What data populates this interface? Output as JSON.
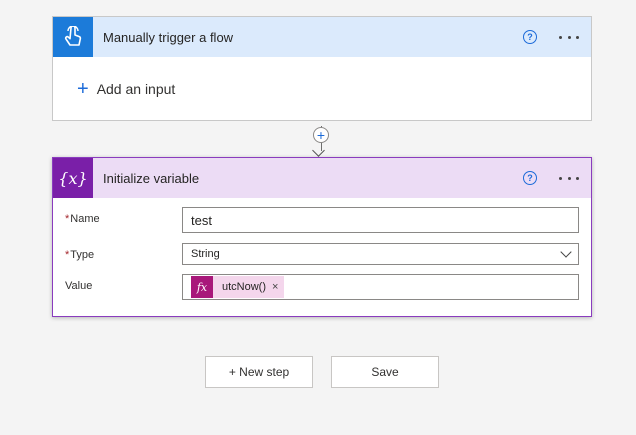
{
  "trigger": {
    "title": "Manually trigger a flow",
    "add_input_label": "Add an input",
    "help_glyph": "?",
    "icon": "touch-hand-icon"
  },
  "variable": {
    "title": "Initialize variable",
    "help_glyph": "?",
    "icon_glyph": "{x}",
    "fields": {
      "name_label": "Name",
      "name_value": "test",
      "type_label": "Type",
      "type_value": "String",
      "value_label": "Value",
      "value_token": "utcNow()",
      "token_glyph": "fx",
      "token_remove": "×"
    },
    "required_mark": "*"
  },
  "connector": {
    "add_glyph": "+"
  },
  "actions": {
    "new_step_label": "+ New step",
    "save_label": "Save"
  },
  "colors": {
    "trigger_accent": "#1c7bd9",
    "variable_accent": "#7a1fa8",
    "expression_accent": "#a8187a"
  }
}
